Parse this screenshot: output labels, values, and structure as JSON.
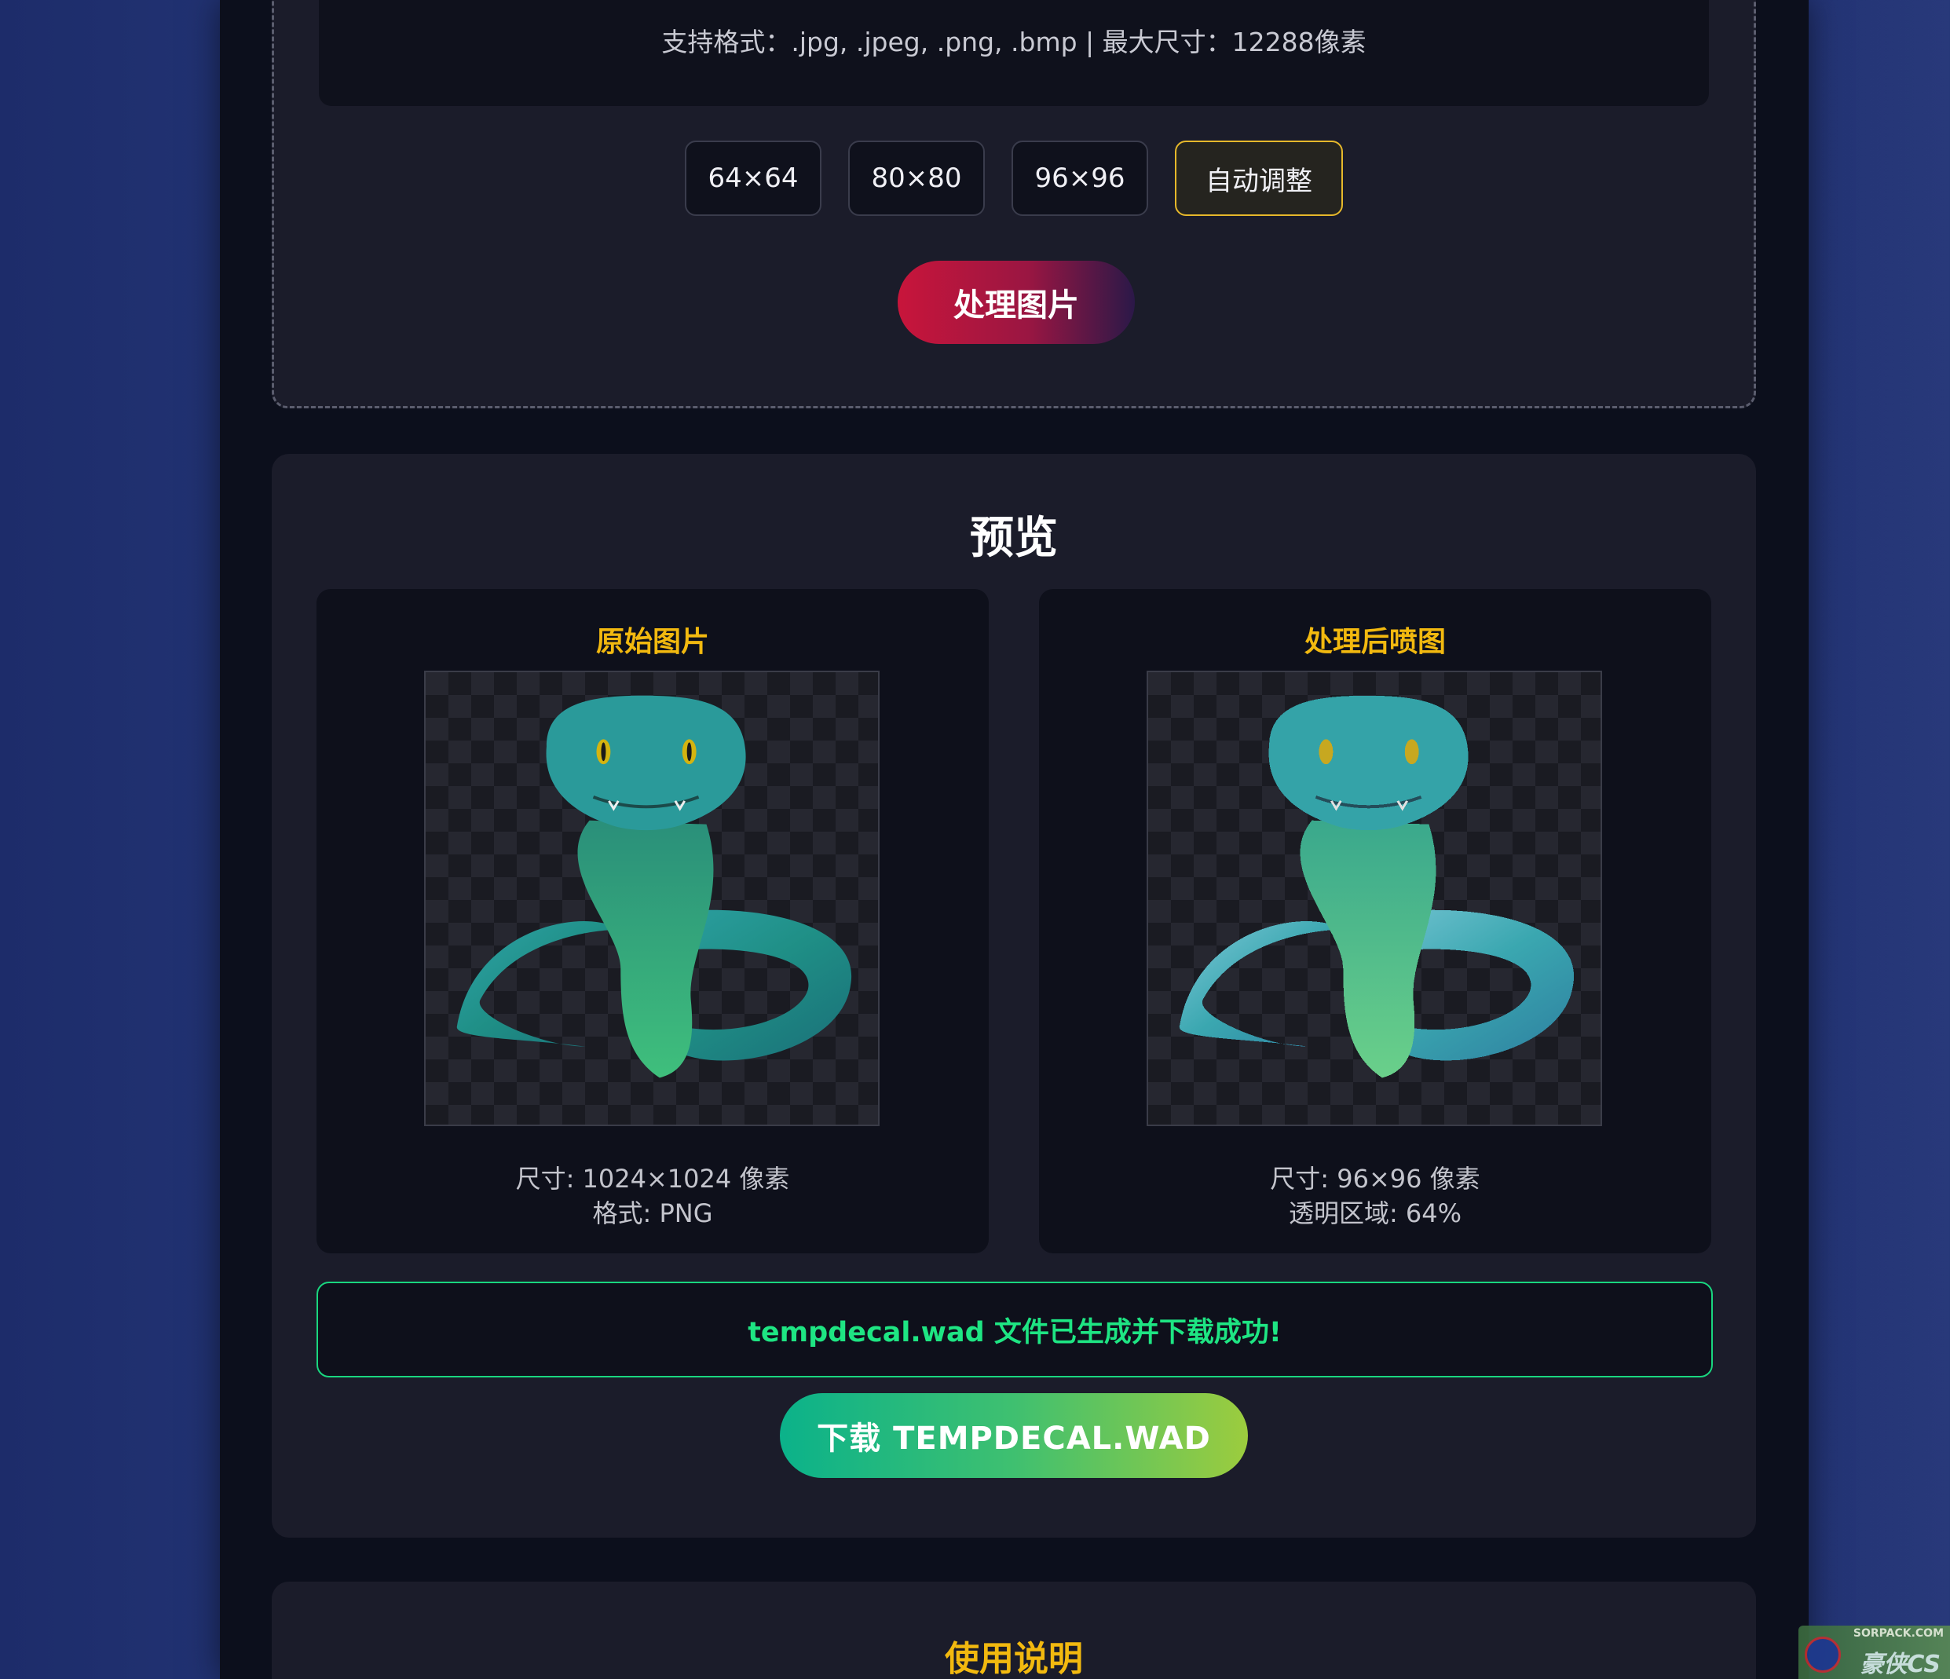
{
  "upload": {
    "format_text": "支持格式：.jpg, .jpeg, .png, .bmp | 最大尺寸：12288像素"
  },
  "size_options": [
    {
      "label": "64×64",
      "selected": false
    },
    {
      "label": "80×80",
      "selected": false
    },
    {
      "label": "96×96",
      "selected": false
    },
    {
      "label": "自动调整",
      "selected": true
    }
  ],
  "process_button": "处理图片",
  "preview": {
    "title": "预览",
    "original": {
      "title": "原始图片",
      "size_line": "尺寸: 1024×1024 像素",
      "format_line": "格式: PNG"
    },
    "processed": {
      "title": "处理后喷图",
      "size_line": "尺寸: 96×96 像素",
      "transparent_line": "透明区域: 64%"
    }
  },
  "success_message": "tempdecal.wad 文件已生成并下载成功!",
  "download_button": "下载 TEMPDECAL.WAD",
  "usage": {
    "title": "使用说明"
  },
  "watermark": {
    "top": "SORPACK.COM",
    "main": "豪侠CS"
  },
  "colors": {
    "accent_gold": "#f2b90f",
    "success_green": "#1ee583",
    "process_red": "#c8153b",
    "download_green": "#3fc070"
  }
}
